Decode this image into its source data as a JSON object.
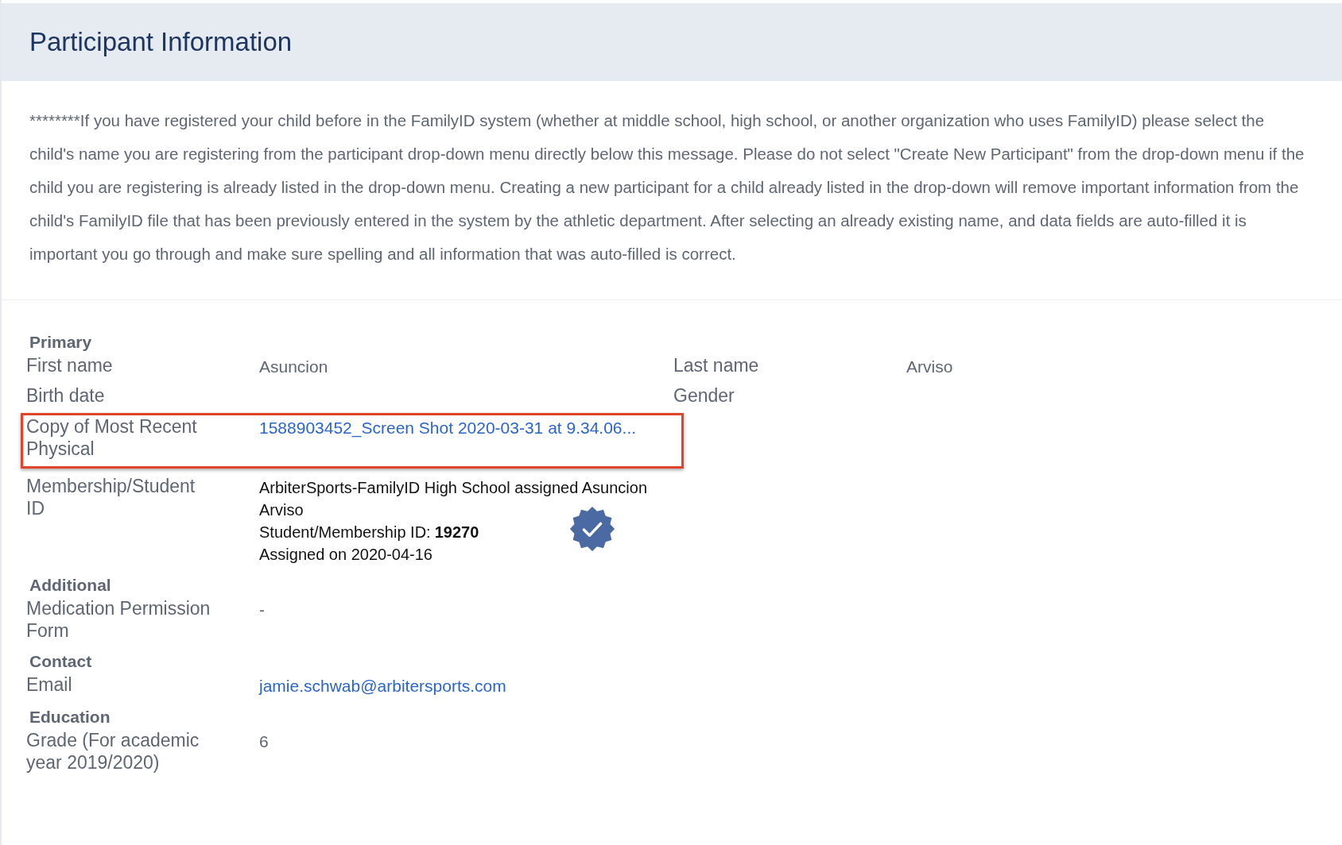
{
  "header": {
    "title": "Participant Information"
  },
  "notice": "********If you have registered your child before in the FamilyID system (whether at middle school, high school, or another organization who uses FamilyID) please select the child's name you are registering from the participant drop-down menu directly below this message. Please do not select \"Create New Participant\" from the drop-down menu if the child you are registering is already listed in the drop-down menu. Creating a new participant for a child already listed in the drop-down will remove important information from the child's FamilyID file that has been previously entered in the system by the athletic department. After selecting an already existing name, and data fields are auto-filled it is important you go through and make sure spelling and all information that was auto-filled is correct.",
  "sections": [
    {
      "title": "Primary",
      "rows": [
        {
          "label": "First name",
          "kind": "text",
          "value": "Asuncion",
          "label2": "Last name",
          "value2": "Arviso",
          "highlighted": false
        },
        {
          "label": "Birth date",
          "kind": "text",
          "value": "",
          "label2": "Gender",
          "value2": "",
          "highlighted": false
        },
        {
          "label": "Copy of Most Recent Physical",
          "kind": "link",
          "value": "1588903452_Screen Shot 2020-03-31 at 9.34.06...",
          "highlighted": true
        },
        {
          "label": "Membership/Student ID",
          "kind": "membership",
          "assigned": "ArbiterSports-FamilyID High School assigned Asuncion Arviso",
          "id_label": "Student/Membership ID:",
          "id_value": "19270",
          "date": "Assigned on 2020-04-16",
          "verified": true,
          "highlighted": false
        }
      ]
    },
    {
      "title": "Additional",
      "rows": [
        {
          "label": "Medication Permission Form",
          "kind": "text",
          "value": "-",
          "highlighted": false
        }
      ]
    },
    {
      "title": "Contact",
      "rows": [
        {
          "label": "Email",
          "kind": "link",
          "value": "jamie.schwab@arbitersports.com",
          "highlighted": false
        }
      ]
    },
    {
      "title": "Education",
      "rows": [
        {
          "label": "Grade (For academic year 2019/2020)",
          "kind": "text",
          "value": "6",
          "highlighted": false
        }
      ]
    }
  ]
}
